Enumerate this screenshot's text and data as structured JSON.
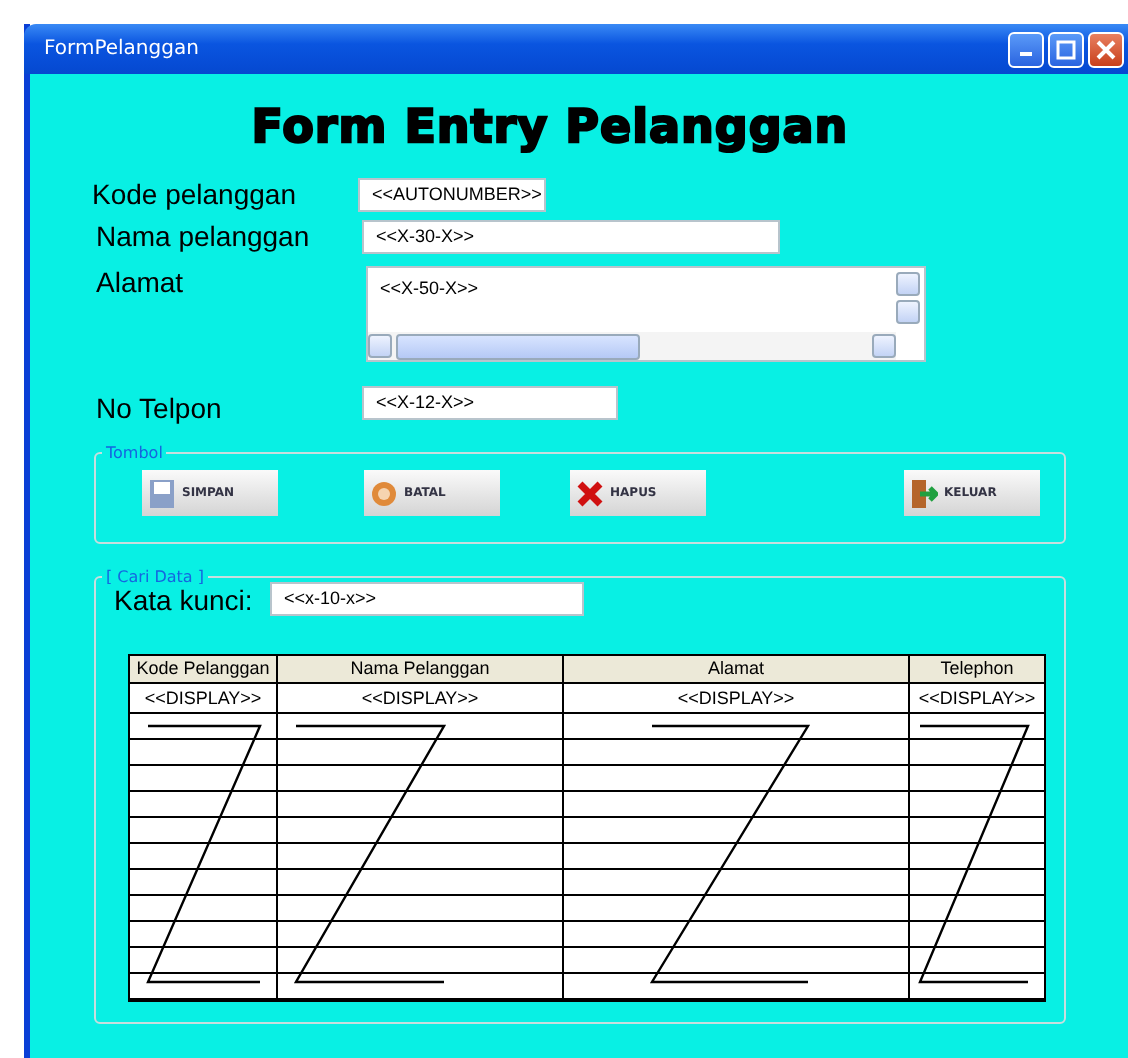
{
  "window": {
    "title": "FormPelanggan"
  },
  "heading": "Form Entry Pelanggan",
  "fields": [
    {
      "label": "Kode pelanggan",
      "value": "<<AUTONUMBER>>",
      "kind": "short"
    },
    {
      "label": "Nama pelanggan",
      "value": "<<X-30-X>>",
      "kind": "long"
    },
    {
      "label": "Alamat",
      "value": "<<X-50-X>>",
      "kind": "area"
    },
    {
      "label": "No Telpon",
      "value": "<<X-12-X>>",
      "kind": "medium"
    }
  ],
  "button_group": {
    "title": "Tombol",
    "buttons": [
      {
        "label": "SIMPAN",
        "kind": "save"
      },
      {
        "label": "BATAL",
        "kind": "cancel"
      },
      {
        "label": "HAPUS",
        "kind": "delete"
      },
      {
        "label": "KELUAR",
        "kind": "exit"
      }
    ]
  },
  "search_group": {
    "title": "[ Cari Data ]",
    "keyword_label": "Kata kunci:",
    "keyword_value": "<<x-10-x>>",
    "table": {
      "columns": [
        "Kode Pelanggan",
        "Nama Pelanggan",
        "Alamat",
        "Telephon"
      ],
      "rows": [
        [
          "<<DISPLAY>>",
          "<<DISPLAY>>",
          "<<DISPLAY>>",
          "<<DISPLAY>>"
        ]
      ]
    }
  }
}
